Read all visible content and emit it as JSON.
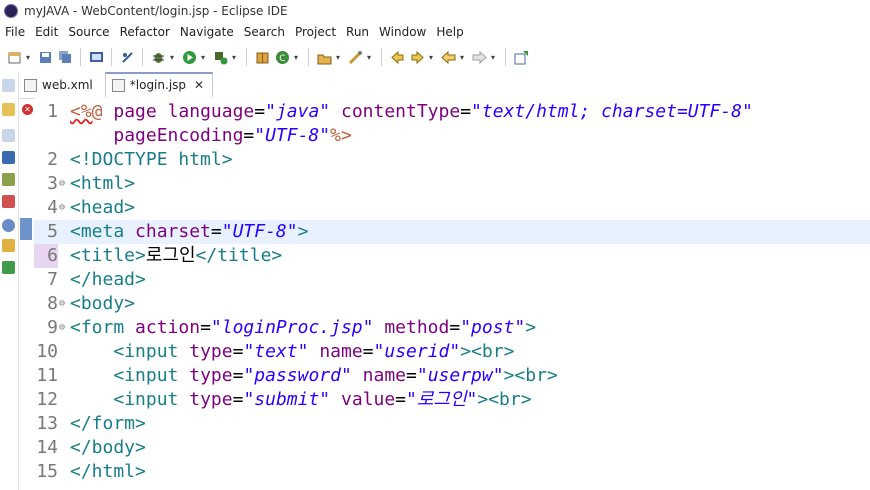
{
  "window": {
    "title": "myJAVA - WebContent/login.jsp - Eclipse IDE"
  },
  "menu": [
    "File",
    "Edit",
    "Source",
    "Refactor",
    "Navigate",
    "Search",
    "Project",
    "Run",
    "Window",
    "Help"
  ],
  "tabs": [
    {
      "label": "web.xml",
      "active": false
    },
    {
      "label": "*login.jsp",
      "active": true
    }
  ],
  "editor": {
    "lines": [
      {
        "num": "1",
        "tokens": [
          [
            "jsp",
            "<%@"
          ],
          [
            "txt",
            " "
          ],
          [
            "attr",
            "page"
          ],
          [
            "txt",
            " "
          ],
          [
            "attr",
            "language"
          ],
          [
            "txt",
            "="
          ],
          [
            "val",
            "\"java\""
          ],
          [
            "txt",
            " "
          ],
          [
            "attr",
            "contentType"
          ],
          [
            "txt",
            "="
          ],
          [
            "val",
            "\"text/html; charset=UTF-8\""
          ]
        ]
      },
      {
        "num": "",
        "tokens": [
          [
            "txt",
            "    "
          ],
          [
            "attr",
            "pageEncoding"
          ],
          [
            "txt",
            "="
          ],
          [
            "val",
            "\"UTF-8\""
          ],
          [
            "jsp",
            "%>"
          ]
        ]
      },
      {
        "num": "2",
        "tokens": [
          [
            "tag",
            "<!DOCTYPE html>"
          ]
        ]
      },
      {
        "num": "3",
        "fold": true,
        "tokens": [
          [
            "tag",
            "<html>"
          ]
        ]
      },
      {
        "num": "4",
        "fold": true,
        "tokens": [
          [
            "tag",
            "<head>"
          ]
        ]
      },
      {
        "num": "5",
        "tokens": [
          [
            "tag",
            "<meta"
          ],
          [
            "txt",
            " "
          ],
          [
            "attr",
            "charset"
          ],
          [
            "txt",
            "="
          ],
          [
            "val",
            "\"UTF-8\""
          ],
          [
            "tag",
            ">"
          ]
        ]
      },
      {
        "num": "6",
        "tokens": [
          [
            "tag",
            "<title>"
          ],
          [
            "txt",
            "로그인"
          ],
          [
            "tag",
            "</title>"
          ]
        ]
      },
      {
        "num": "7",
        "tokens": [
          [
            "tag",
            "</head>"
          ]
        ]
      },
      {
        "num": "8",
        "fold": true,
        "tokens": [
          [
            "tag",
            "<body>"
          ]
        ]
      },
      {
        "num": "9",
        "fold": true,
        "tokens": [
          [
            "tag",
            "<form"
          ],
          [
            "txt",
            " "
          ],
          [
            "attr",
            "action"
          ],
          [
            "txt",
            "="
          ],
          [
            "val",
            "\"loginProc.jsp\""
          ],
          [
            "txt",
            " "
          ],
          [
            "attr",
            "method"
          ],
          [
            "txt",
            "="
          ],
          [
            "val",
            "\"post\""
          ],
          [
            "tag",
            ">"
          ]
        ]
      },
      {
        "num": "10",
        "tokens": [
          [
            "txt",
            "    "
          ],
          [
            "tag",
            "<input"
          ],
          [
            "txt",
            " "
          ],
          [
            "attr",
            "type"
          ],
          [
            "txt",
            "="
          ],
          [
            "val",
            "\"text\""
          ],
          [
            "txt",
            " "
          ],
          [
            "attr",
            "name"
          ],
          [
            "txt",
            "="
          ],
          [
            "val",
            "\"userid\""
          ],
          [
            "tag",
            "><br>"
          ]
        ]
      },
      {
        "num": "11",
        "tokens": [
          [
            "txt",
            "    "
          ],
          [
            "tag",
            "<input"
          ],
          [
            "txt",
            " "
          ],
          [
            "attr",
            "type"
          ],
          [
            "txt",
            "="
          ],
          [
            "val",
            "\"password\""
          ],
          [
            "txt",
            " "
          ],
          [
            "attr",
            "name"
          ],
          [
            "txt",
            "="
          ],
          [
            "val",
            "\"userpw\""
          ],
          [
            "tag",
            "><br>"
          ]
        ]
      },
      {
        "num": "12",
        "tokens": [
          [
            "txt",
            "    "
          ],
          [
            "tag",
            "<input"
          ],
          [
            "txt",
            " "
          ],
          [
            "attr",
            "type"
          ],
          [
            "txt",
            "="
          ],
          [
            "val",
            "\"submit\""
          ],
          [
            "txt",
            " "
          ],
          [
            "attr",
            "value"
          ],
          [
            "txt",
            "="
          ],
          [
            "val",
            "\"로그인\""
          ],
          [
            "tag",
            "><br>"
          ]
        ]
      },
      {
        "num": "13",
        "tokens": [
          [
            "tag",
            "</form>"
          ]
        ]
      },
      {
        "num": "14",
        "tokens": [
          [
            "tag",
            "</body>"
          ]
        ]
      },
      {
        "num": "15",
        "tokens": [
          [
            "tag",
            "</html>"
          ]
        ]
      }
    ]
  }
}
